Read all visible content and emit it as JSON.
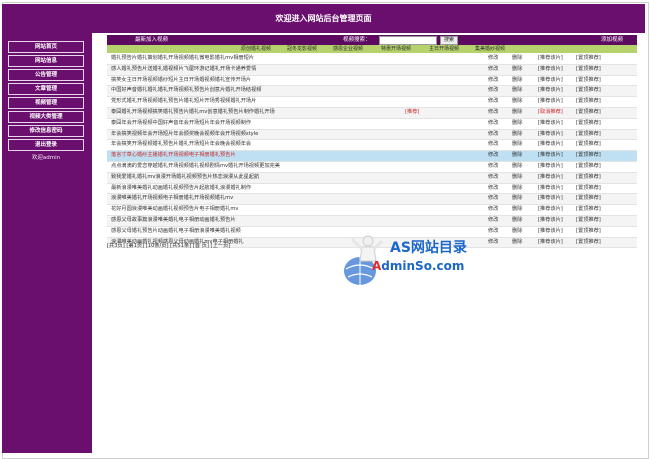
{
  "header": {
    "title": "欢迎进入网站后台管理页面"
  },
  "sidebar": {
    "items": [
      {
        "label": "网站首页"
      },
      {
        "label": "网站信息"
      },
      {
        "label": "公告管理"
      },
      {
        "label": "文章管理"
      },
      {
        "label": "视频管理"
      },
      {
        "label": "视频大类管理"
      },
      {
        "label": "修改信息密码"
      },
      {
        "label": "退出登录"
      }
    ],
    "welcome": "欢迎admin"
  },
  "toolbar": {
    "latest_label": "最新加入视频",
    "search_label": "视频搜索：",
    "search_value": "",
    "search_button": "搜索",
    "add_label": "添加视频"
  },
  "categories": [
    "原创婚礼视频",
    "冠冬龙影视频",
    "感恩企业视频",
    "特惠开场视频",
    "主日开场视频",
    "集美婚纱视频"
  ],
  "row_actions": {
    "edit": "修改",
    "delete": "删除"
  },
  "rows": [
    {
      "title": "婚礼预告片婚礼策划婚礼开场视频婚礼微电影婚礼mv相册短片",
      "tag": "",
      "rec": "[推荐该片]",
      "top": "[置顶推荐]"
    },
    {
      "title": "感人婚礼预告片送婚礼婚视频片飞屋环游记婚礼开场卡通养爱情",
      "tag": "",
      "rec": "[推荐该片]",
      "top": "[置顶推荐]"
    },
    {
      "title": "搞笑女主日开场视频婚纱短片主日开场婚视频婚礼宣传开场片",
      "tag": "",
      "rec": "[推荐该片]",
      "top": "[置顶推荐]"
    },
    {
      "title": "中国好声音婚礼婚礼婚礼开场视频礼预告片创意片婚礼开场结视频",
      "tag": "",
      "rec": "[推荐该片]",
      "top": "[置顶推荐]"
    },
    {
      "title": "党形式婚礼开场视频婚礼预告片婚礼短片开场秀视频婚礼开场片",
      "tag": "",
      "rec": "[推荐该片]",
      "top": "[置顶推荐]"
    },
    {
      "title": "泰囧婚礼开场视频搞笑婚礼预告片婚礼mv创意婚礼预告片制作婚礼开场",
      "tag": "[推荐]",
      "rec": "[取消推荐]",
      "top": "[置顶推荐]"
    },
    {
      "title": "泰囧年会开场视频中国好声音年会开场短片年会开场视频制作",
      "tag": "",
      "rec": "[推荐该片]",
      "top": "[置顶推荐]"
    },
    {
      "title": "年会搞笑视频年会开场短片年会颁奖晚会视频年会开场视频style",
      "tag": "",
      "rec": "[推荐该片]",
      "top": "[置顶推荐]"
    },
    {
      "title": "年会搞笑开场视频婚礼预告片婚礼开场短片年会晚会视频年会",
      "tag": "",
      "rec": "[推荐该片]",
      "top": "[置顶推荐]"
    },
    {
      "title": "落言寸草心婚纱主播婚礼开场视频电子相册婚礼预告片",
      "tag": "",
      "rec": "[推荐该片]",
      "top": "[置顶推荐]"
    },
    {
      "title": "点点滴滴的爱恋穿越婚礼开场视频婚礼视频剧情mv婚礼开场视频更加完美",
      "tag": "",
      "rec": "[推荐该片]",
      "top": "[置顶推荐]"
    },
    {
      "title": "致我爱婚礼婚礼mv浪漫开场婚礼视频预告片热恋浪漫从此星起航",
      "tag": "",
      "rec": "[推荐该片]",
      "top": "[置顶推荐]"
    },
    {
      "title": "最新浪漫唯美婚礼动画婚礼视频预告片起航婚礼浪漫婚礼制作",
      "tag": "",
      "rec": "[推荐该片]",
      "top": "[置顶推荐]"
    },
    {
      "title": "浪漫唯美婚礼开场视频电子相册婚礼开场视频婚礼mv",
      "tag": "",
      "rec": "[推荐该片]",
      "top": "[置顶推荐]"
    },
    {
      "title": "花好月圆浪漫唯美动画婚礼视频预告片电子相册婚礼mv",
      "tag": "",
      "rec": "[推荐该片]",
      "top": "[置顶推荐]"
    },
    {
      "title": "感恩父母故事篇浪漫唯美婚礼电子相册动画婚礼预告片",
      "tag": "",
      "rec": "[推荐该片]",
      "top": "[置顶推荐]"
    },
    {
      "title": "感恩父母婚礼预告片动画婚礼电子相册浪漫唯美婚礼视频",
      "tag": "",
      "rec": "[推荐该片]",
      "top": "[置顶推荐]"
    },
    {
      "title": "浪漫唯美动画婚礼视频感恩父母动画婚礼mv电子相册婚礼",
      "tag": "",
      "rec": "[推荐该片]",
      "top": "[置顶推荐]"
    }
  ],
  "pager": {
    "text": "[共3页] [第1页] [10条/页] [共51条] [首 页] [上一页]"
  },
  "watermark": {
    "line1": "AS网站目录",
    "line2_red": "A",
    "line2_blue": "dminSo.com"
  }
}
